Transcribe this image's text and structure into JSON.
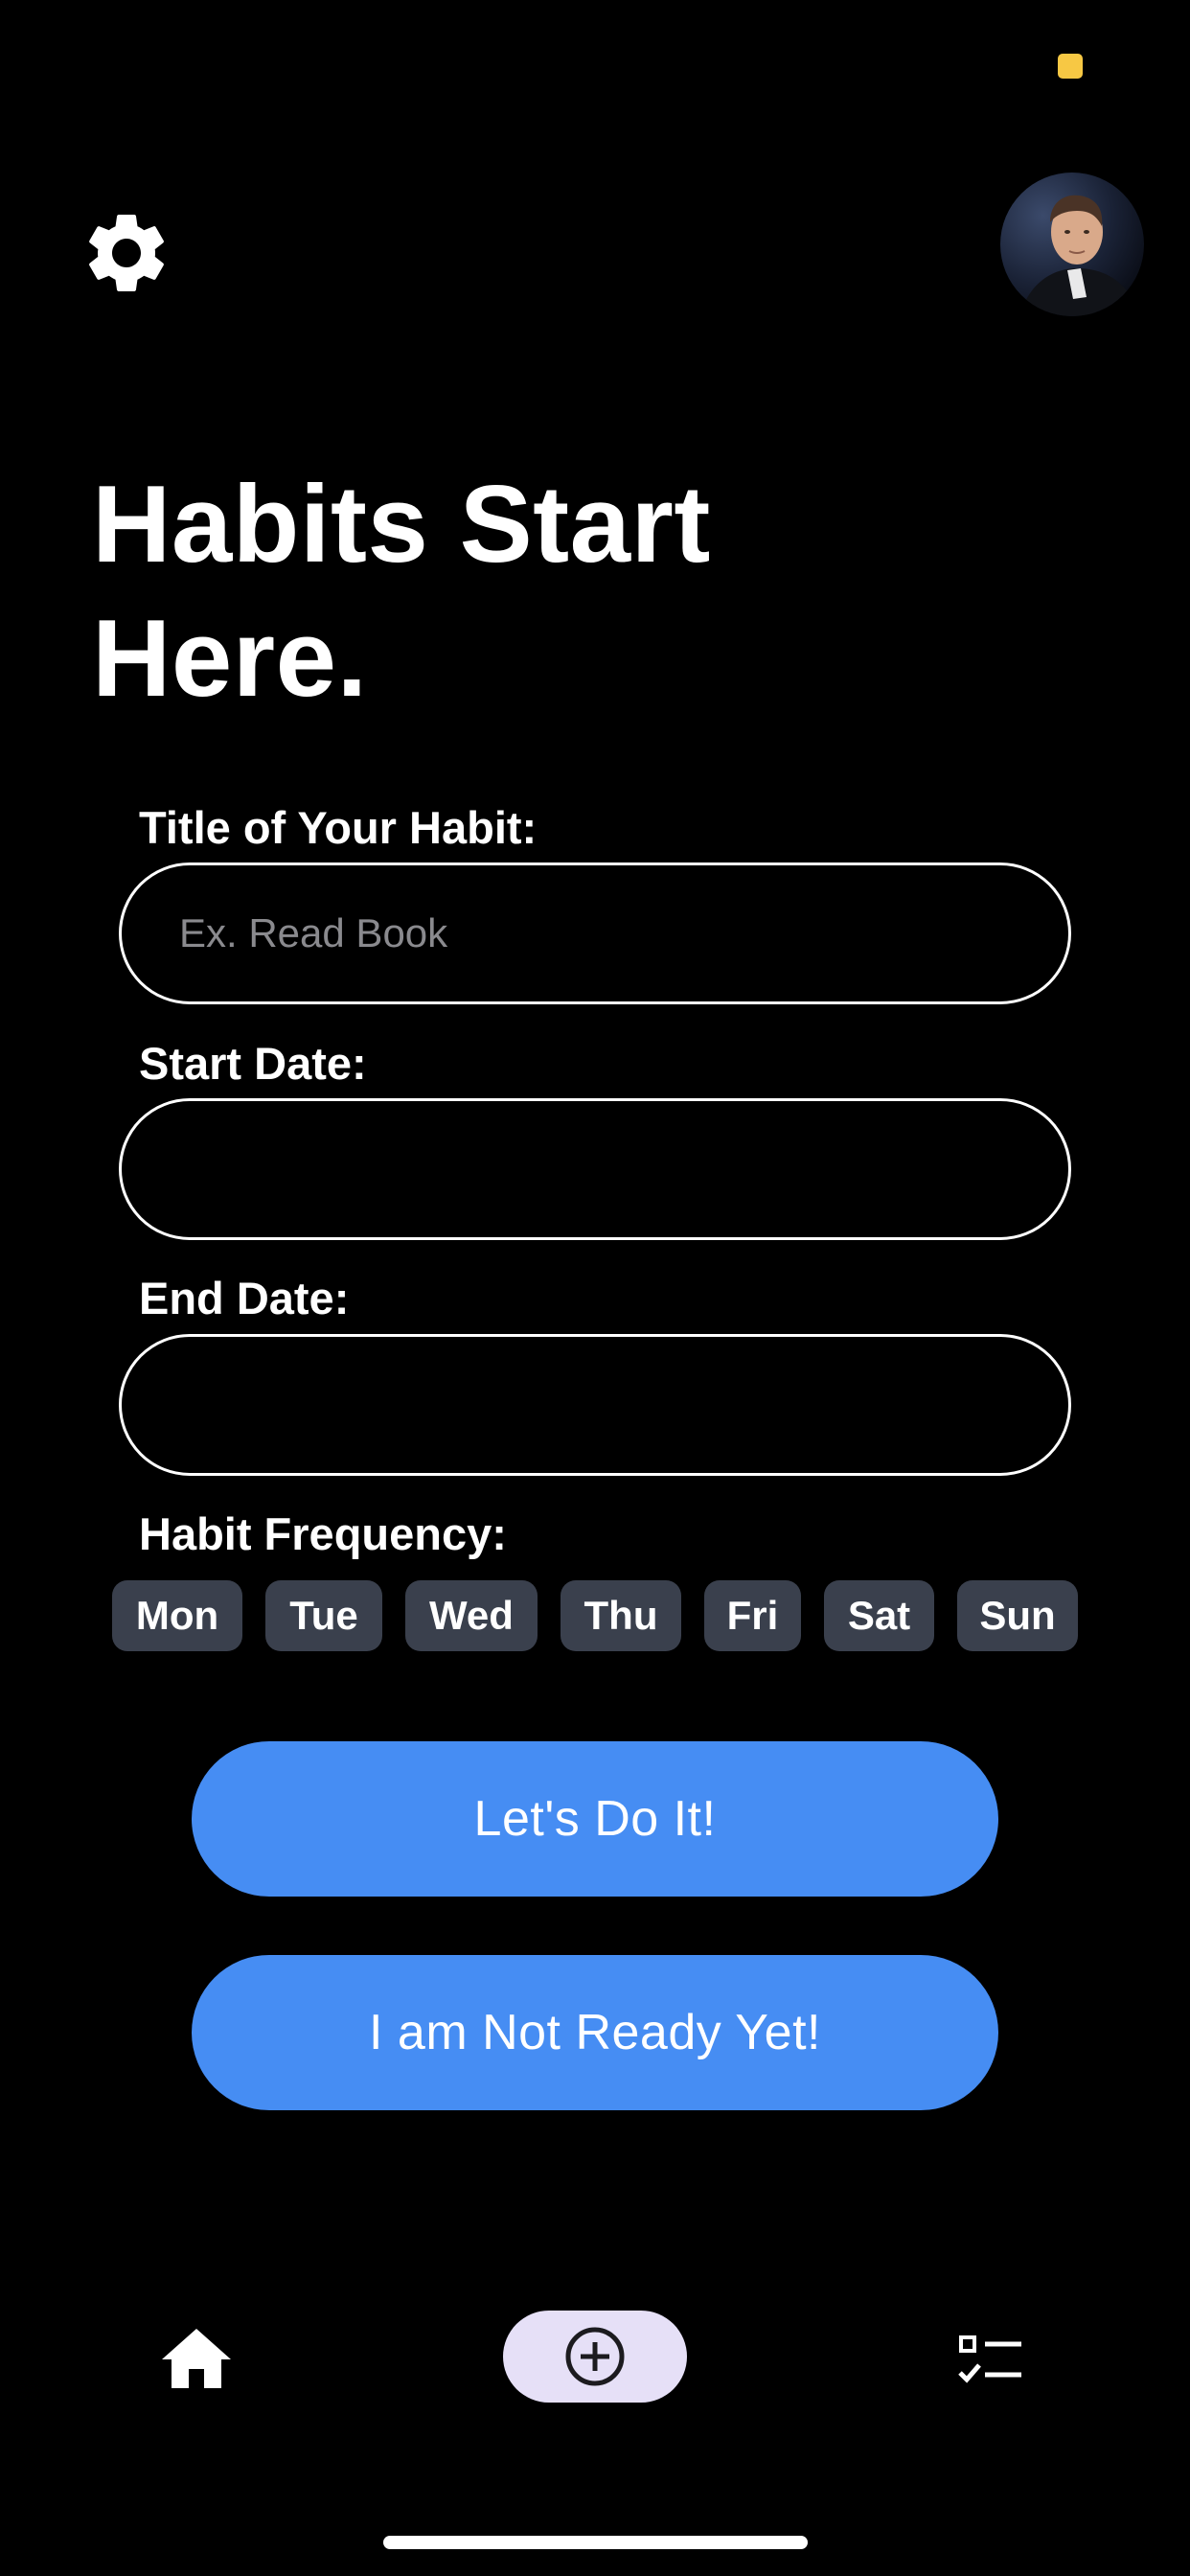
{
  "header": {
    "settings_icon": "gear-icon",
    "avatar": "user-avatar"
  },
  "page": {
    "title": "Habits Start Here."
  },
  "form": {
    "title_label": "Title of Your Habit:",
    "title_placeholder": "Ex. Read Book",
    "title_value": "",
    "start_date_label": "Start Date:",
    "start_date_value": "",
    "end_date_label": "End Date:",
    "end_date_value": "",
    "frequency_label": "Habit Frequency:",
    "days": [
      "Mon",
      "Tue",
      "Wed",
      "Thu",
      "Fri",
      "Sat",
      "Sun"
    ]
  },
  "actions": {
    "confirm_label": "Let's Do It!",
    "decline_label": "I am Not Ready Yet!"
  },
  "nav": {
    "home_icon": "home-icon",
    "add_icon": "plus-circle-icon",
    "list_icon": "checklist-icon"
  },
  "colors": {
    "background": "#000000",
    "primary": "#468df3",
    "chip": "#3a404d",
    "nav_active": "#e6e0f7",
    "status_dot": "#f7c844"
  }
}
